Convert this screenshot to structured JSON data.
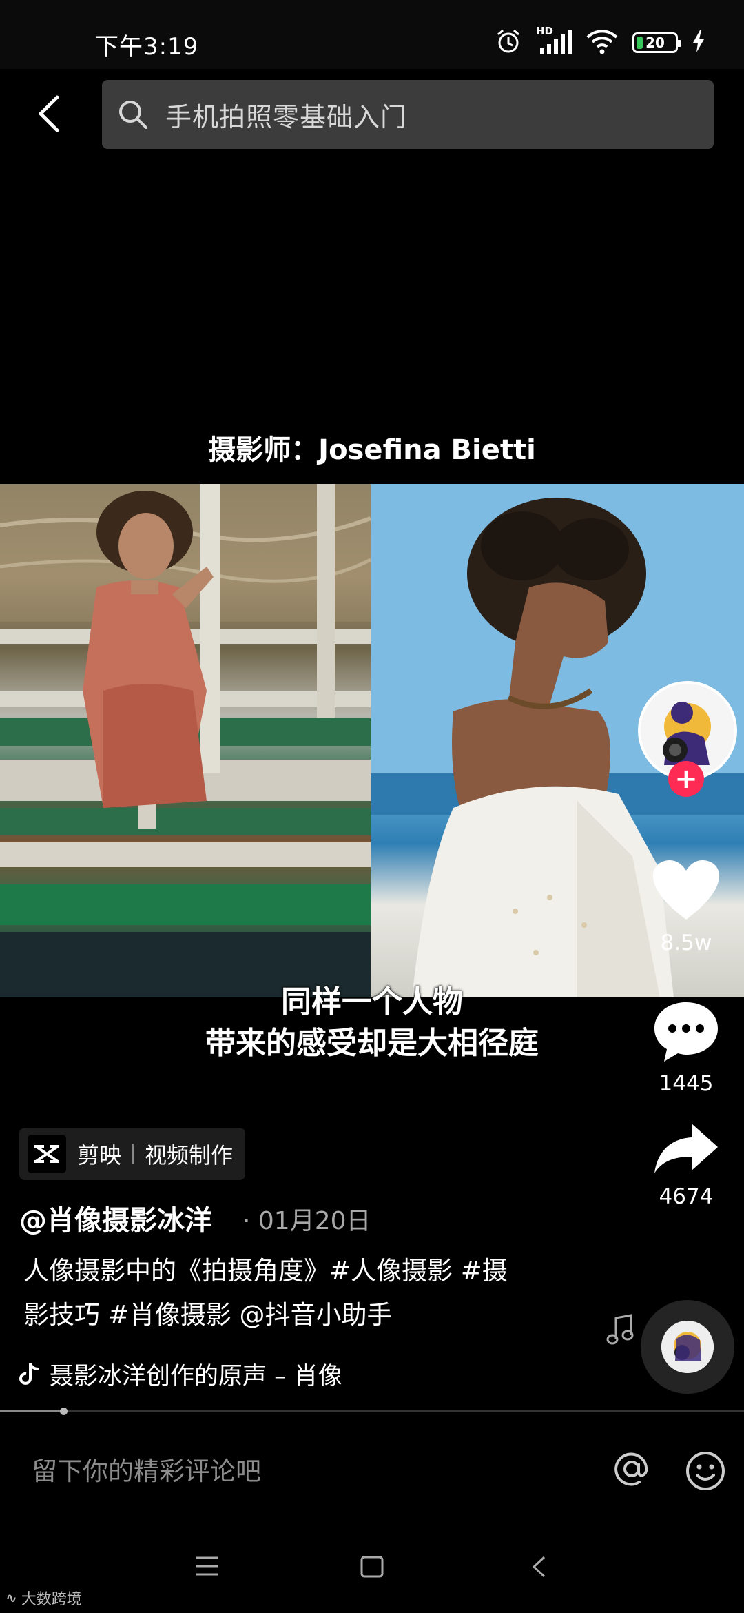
{
  "status_bar": {
    "time": "下午3:19",
    "network_label": "HD",
    "battery": "20",
    "battery_level": 0.2
  },
  "search": {
    "query": "手机拍照零基础入门"
  },
  "video": {
    "title_overlay": "摄影师：Josefina Bietti",
    "subtitle_line1": "同样一个人物",
    "subtitle_line2": "带来的感受却是大相径庭",
    "progress": 0.085
  },
  "actions": {
    "likes": "8.5w",
    "comments": "1445",
    "shares": "4674"
  },
  "capcut": {
    "app_name": "剪映",
    "label": "视频制作"
  },
  "post": {
    "author": "@肖像摄影冰洋",
    "date": "01月20日",
    "description_line1": "人像摄影中的《拍摄角度》#人像摄影 #摄",
    "description_line2": "影技巧 #肖像摄影 @抖音小助手",
    "sound": "聂影冰洋创作的原声 – 肖像"
  },
  "comment": {
    "placeholder": "留下你的精彩评论吧"
  },
  "watermark": {
    "text": "大数跨境"
  },
  "colors": {
    "accent": "#fe2c55",
    "battery": "#35c759",
    "search_bg": "#3c3c3c"
  }
}
